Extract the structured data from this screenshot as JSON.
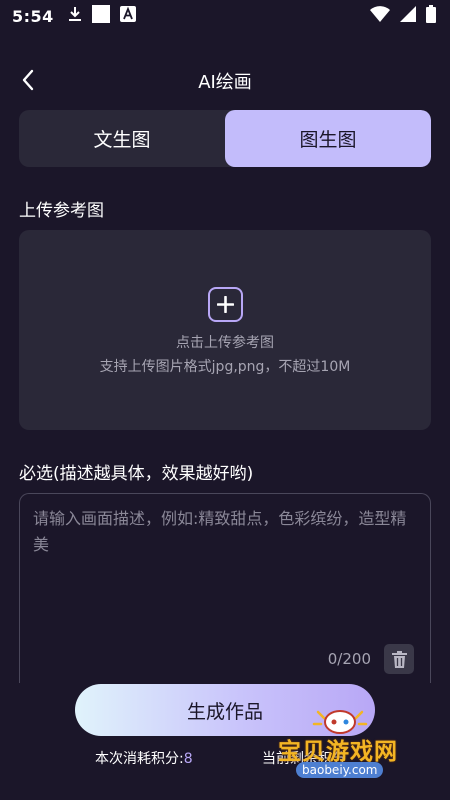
{
  "status_bar": {
    "time": "5:54",
    "icons": [
      "download-icon",
      "square-icon",
      "a-badge-icon",
      "wifi-icon",
      "signal-icon",
      "battery-icon"
    ]
  },
  "header": {
    "title": "AI绘画",
    "back_icon": "chevron-left-icon"
  },
  "tabs": [
    {
      "label": "文生图",
      "active": false
    },
    {
      "label": "图生图",
      "active": true
    }
  ],
  "upload": {
    "section_label": "上传参考图",
    "icon": "plus-icon",
    "text": "点击上传参考图",
    "hint": "支持上传图片格式jpg,png，不超过10M"
  },
  "prompt": {
    "section_label": "必选(描述越具体，效果越好哟)",
    "placeholder": "请输入画面描述，例如:精致甜点，色彩缤纷，造型精美",
    "value": "",
    "char_count": "0/200",
    "delete_icon": "trash-icon"
  },
  "actions": {
    "generate_label": "生成作品",
    "cost_label": "本次消耗积分:",
    "cost_value": "8",
    "remain_label": "当前剩余积分"
  },
  "watermark": {
    "title": "宝贝游戏网",
    "url": "baobeiy.com"
  },
  "colors": {
    "background": "#1b1629",
    "card": "#2a2838",
    "accent": "#b8a7f6",
    "active_tab": "#c3bcfb",
    "muted_text": "#a6a4b2"
  }
}
